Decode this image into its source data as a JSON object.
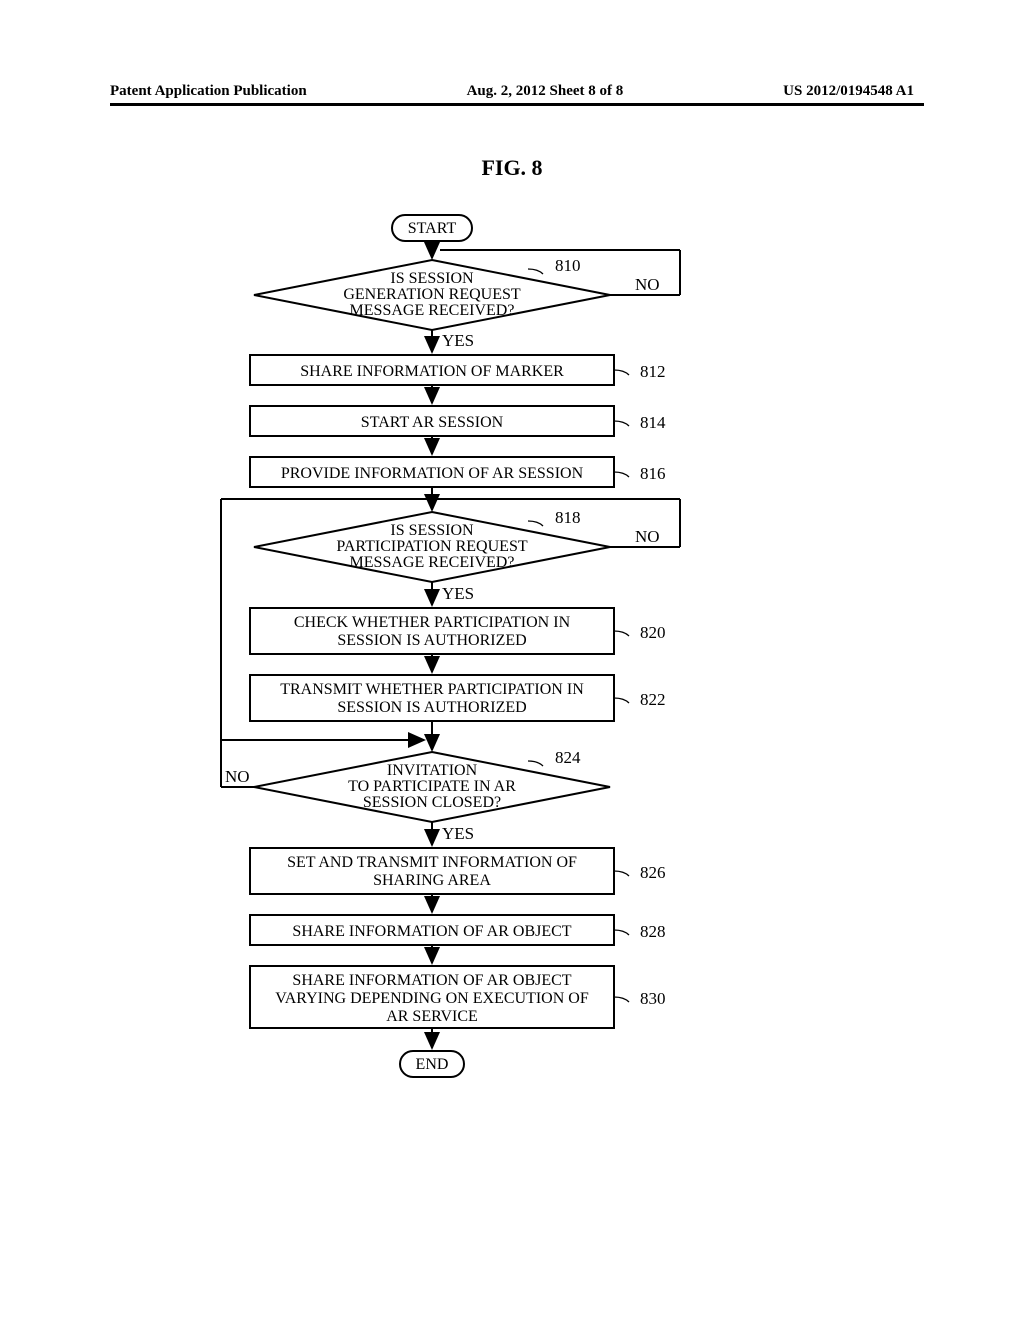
{
  "header": {
    "left": "Patent Application Publication",
    "center": "Aug. 2, 2012  Sheet 8 of 8",
    "right": "US 2012/0194548 A1"
  },
  "figure_title": "FIG. 8",
  "flowchart": {
    "start": "START",
    "end": "END",
    "d810": {
      "l1": "IS SESSION",
      "l2": "GENERATION REQUEST",
      "l3": "MESSAGE RECEIVED?",
      "num": "810"
    },
    "b812": {
      "text": "SHARE INFORMATION OF MARKER",
      "num": "812"
    },
    "b814": {
      "text": "START AR SESSION",
      "num": "814"
    },
    "b816": {
      "text": "PROVIDE INFORMATION OF AR SESSION",
      "num": "816"
    },
    "d818": {
      "l1": "IS SESSION",
      "l2": "PARTICIPATION REQUEST",
      "l3": "MESSAGE RECEIVED?",
      "num": "818"
    },
    "b820": {
      "l1": "CHECK WHETHER PARTICIPATION IN",
      "l2": "SESSION IS AUTHORIZED",
      "num": "820"
    },
    "b822": {
      "l1": "TRANSMIT WHETHER PARTICIPATION IN",
      "l2": "SESSION IS AUTHORIZED",
      "num": "822"
    },
    "d824": {
      "l1": "INVITATION",
      "l2": "TO PARTICIPATE IN AR",
      "l3": "SESSION CLOSED?",
      "num": "824"
    },
    "b826": {
      "l1": "SET AND TRANSMIT INFORMATION OF",
      "l2": "SHARING AREA",
      "num": "826"
    },
    "b828": {
      "text": "SHARE INFORMATION OF AR OBJECT",
      "num": "828"
    },
    "b830": {
      "l1": "SHARE INFORMATION OF AR OBJECT",
      "l2": "VARYING DEPENDING ON EXECUTION OF",
      "l3": "AR SERVICE",
      "num": "830"
    },
    "yes": "YES",
    "no": "NO"
  }
}
